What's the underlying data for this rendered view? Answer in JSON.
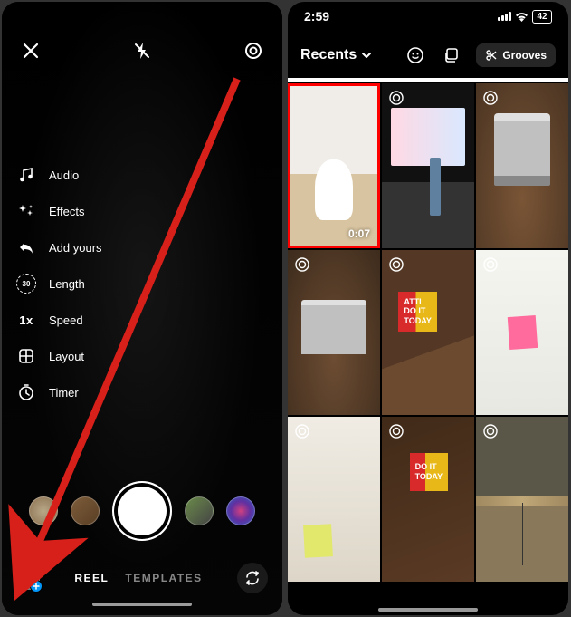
{
  "status": {
    "time": "2:59",
    "battery": "42"
  },
  "left": {
    "side_menu": {
      "audio": "Audio",
      "effects": "Effects",
      "add_yours": "Add yours",
      "length": "Length",
      "length_value": "30",
      "speed": "Speed",
      "speed_value": "1x",
      "layout": "Layout",
      "timer": "Timer"
    },
    "modes": {
      "reel": "REEL",
      "templates": "TEMPLATES"
    }
  },
  "right": {
    "album_dropdown": "Recents",
    "grooves_label": "Grooves",
    "grid": {
      "items": [
        {
          "duration": "0:07",
          "highlighted": true,
          "burst": false
        },
        {
          "burst": true
        },
        {
          "burst": true
        },
        {
          "burst": true
        },
        {
          "burst": true
        },
        {
          "burst": true
        },
        {
          "burst": true
        },
        {
          "burst": true
        },
        {
          "burst": true
        }
      ]
    }
  }
}
